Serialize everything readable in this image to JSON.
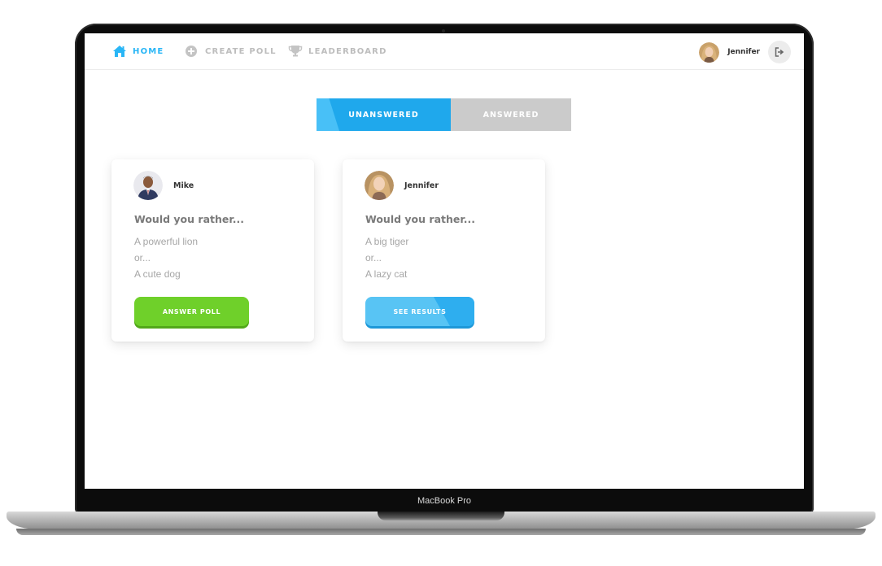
{
  "device": {
    "brand_label": "MacBook Pro"
  },
  "nav": {
    "items": [
      {
        "label": "HOME",
        "icon": "home-icon",
        "active": true
      },
      {
        "label": "CREATE POLL",
        "icon": "plus-circle-icon",
        "active": false
      },
      {
        "label": "LEADERBOARD",
        "icon": "trophy-icon",
        "active": false
      }
    ],
    "user": {
      "name": "Jennifer",
      "avatar": "user-avatar",
      "logout_icon": "logout-icon"
    }
  },
  "tabs": [
    {
      "label": "UNANSWERED",
      "active": true
    },
    {
      "label": "ANSWERED",
      "active": false
    }
  ],
  "polls": [
    {
      "author": "Mike",
      "question": "Would you rather...",
      "option_one": "A powerful lion",
      "separator": "or...",
      "option_two": "A cute dog",
      "button_label": "ANSWER POLL"
    },
    {
      "author": "Jennifer",
      "question": "Would you rather...",
      "option_one": "A big tiger",
      "separator": "or...",
      "option_two": "A lazy cat",
      "button_label": "SEE RESULTS"
    }
  ],
  "colors": {
    "accent": "#29b6f6",
    "tab_active": "#1fa8ec",
    "tab_inactive": "#cbcbcb",
    "answer_button": "#6fd02a",
    "results_button": "#58c4f4"
  }
}
